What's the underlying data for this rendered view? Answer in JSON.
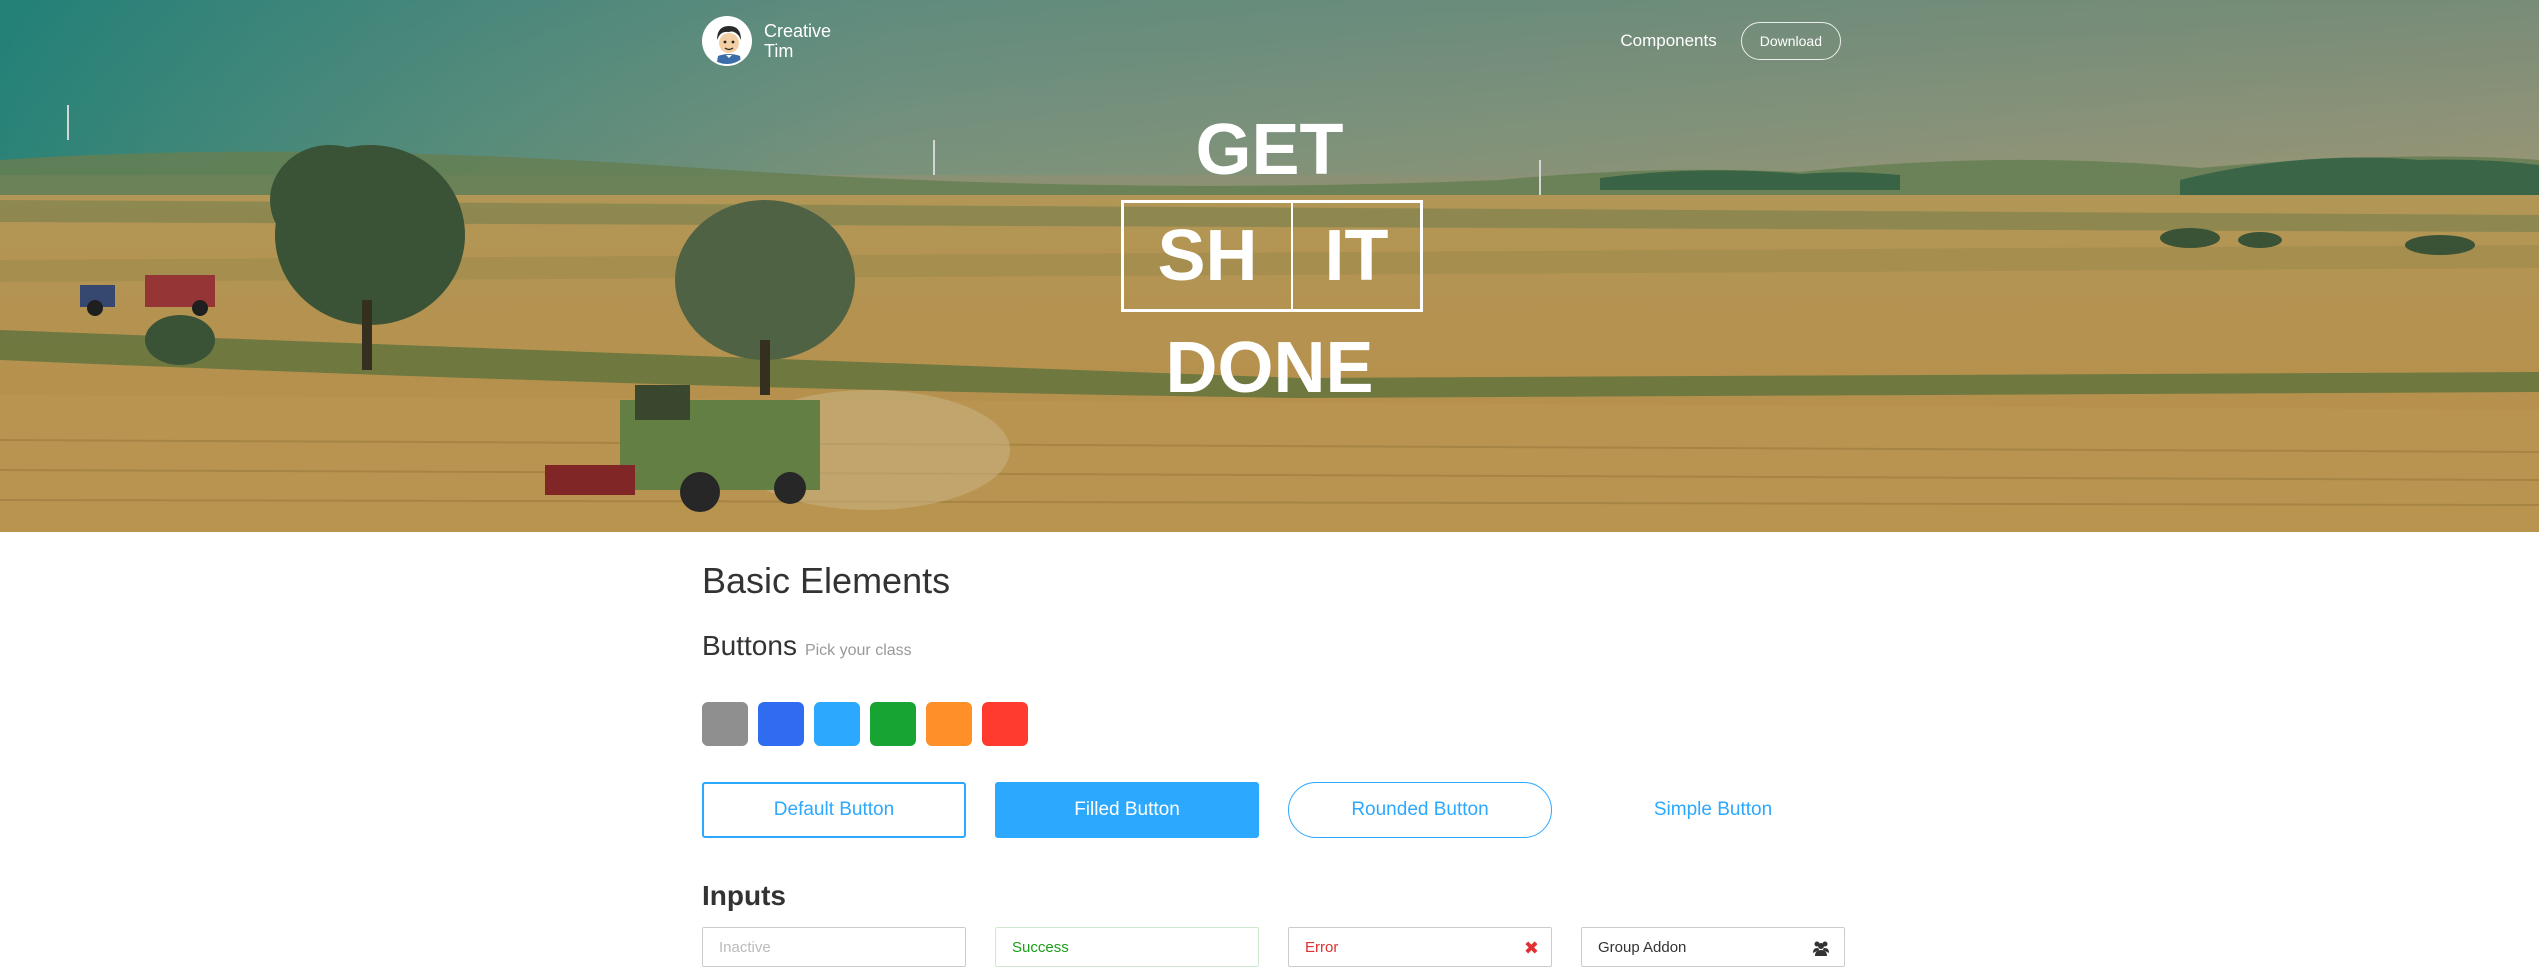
{
  "nav": {
    "brand_line1": "Creative",
    "brand_line2": "Tim",
    "components_label": "Components",
    "download_label": "Download"
  },
  "hero": {
    "line_top": "GET",
    "box_left": "SH",
    "box_right": "IT",
    "line_bottom": "DONE"
  },
  "basic": {
    "title": "Basic Elements",
    "buttons_heading": "Buttons",
    "buttons_subheading": "Pick your class",
    "swatches": [
      "#8f8f8f",
      "#2f6cf0",
      "#2ca8ff",
      "#18a432",
      "#ff8f28",
      "#ff3b30"
    ],
    "default_button": "Default Button",
    "filled_button": "Filled Button",
    "rounded_button": "Rounded Button",
    "simple_button": "Simple Button"
  },
  "inputs": {
    "title": "Inputs",
    "inactive_placeholder": "Inactive",
    "success_value": "Success",
    "error_value": "Error",
    "group_addon_value": "Group Addon"
  },
  "colors": {
    "primary": "#2ca8ff",
    "success": "#1a9f1a",
    "error": "#e03030"
  },
  "icons": {
    "error": "close-icon",
    "addon": "users-icon"
  }
}
